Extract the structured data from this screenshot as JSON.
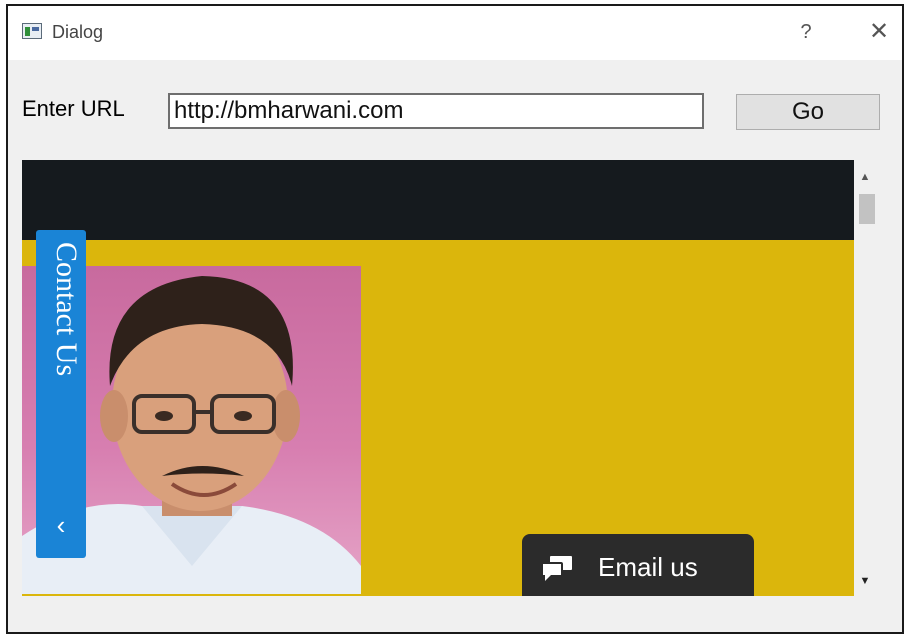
{
  "window": {
    "title": "Dialog",
    "help_glyph": "?",
    "close_glyph": "✕",
    "app_icon": "app-window-icon"
  },
  "form": {
    "url_label": "Enter URL",
    "url_value": "http://bmharwani.com",
    "go_label": "Go"
  },
  "webpage": {
    "contact_tab_label": "Contact Us",
    "contact_chevron": "‹",
    "email_label": "Email us",
    "email_icon": "chat-bubbles-icon",
    "colors": {
      "header_bar": "#151a1e",
      "background": "#dbb60c",
      "contact_tab": "#1a84d6",
      "email_button": "#2b2b2b"
    }
  },
  "scrollbar": {
    "up_glyph": "▲",
    "down_glyph": "▼"
  }
}
